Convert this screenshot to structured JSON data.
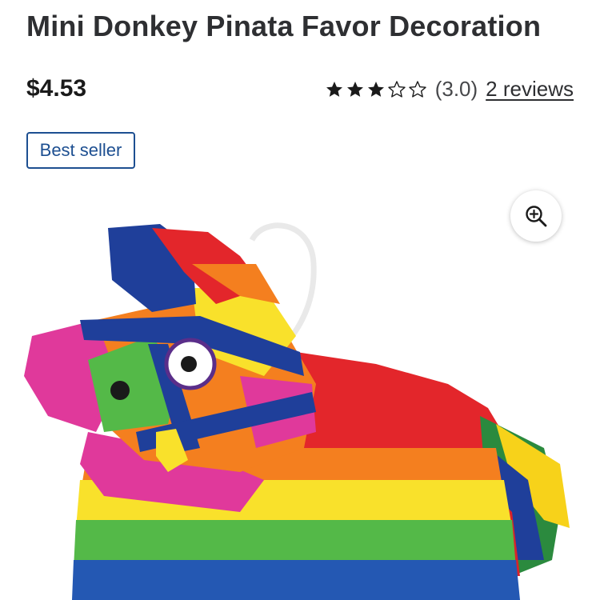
{
  "product": {
    "title": "Mini Donkey Pinata Favor Decoration",
    "price": "$4.53",
    "badge": "Best seller",
    "image_alt": "Colorful mini donkey pinata"
  },
  "rating": {
    "value": 3.0,
    "max": 5,
    "text": "(3.0)",
    "reviews_text": "2 reviews",
    "star_color": "#1a1a1a"
  },
  "icons": {
    "zoom": "zoom-in-icon",
    "star_filled": "star-filled-icon",
    "star_empty": "star-outline-icon"
  },
  "colors": {
    "badge_blue": "#1d4f91",
    "text": "#2e2f32"
  }
}
